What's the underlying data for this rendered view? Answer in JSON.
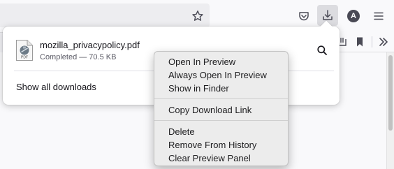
{
  "download": {
    "file_name": "mozilla_privacypolicy.pdf",
    "status": "Completed — 70.5 KB",
    "file_type": "PDF"
  },
  "panel": {
    "show_all_label": "Show all downloads"
  },
  "toolbar": {
    "account_initial": "A"
  },
  "context_menu": {
    "open_in_preview": "Open In Preview",
    "always_open_in_preview": "Always Open In Preview",
    "show_in_finder": "Show in Finder",
    "copy_download_link": "Copy Download Link",
    "delete": "Delete",
    "remove_from_history": "Remove From History",
    "clear_preview_panel": "Clear Preview Panel"
  },
  "icons": {
    "bookmark_star": "star-icon",
    "pocket": "pocket-icon",
    "downloads": "download-icon",
    "account": "account-icon",
    "menu": "hamburger-menu-icon",
    "library": "library-icon",
    "bookmark": "bookmark-icon",
    "overflow": "chevron-double-right-icon",
    "show_in_folder": "magnifier-icon",
    "file": "pdf-file-icon"
  },
  "colors": {
    "accent_icon": "#4a4a55",
    "context_menu_bg": "#ececec",
    "panel_bg": "#ffffff"
  }
}
